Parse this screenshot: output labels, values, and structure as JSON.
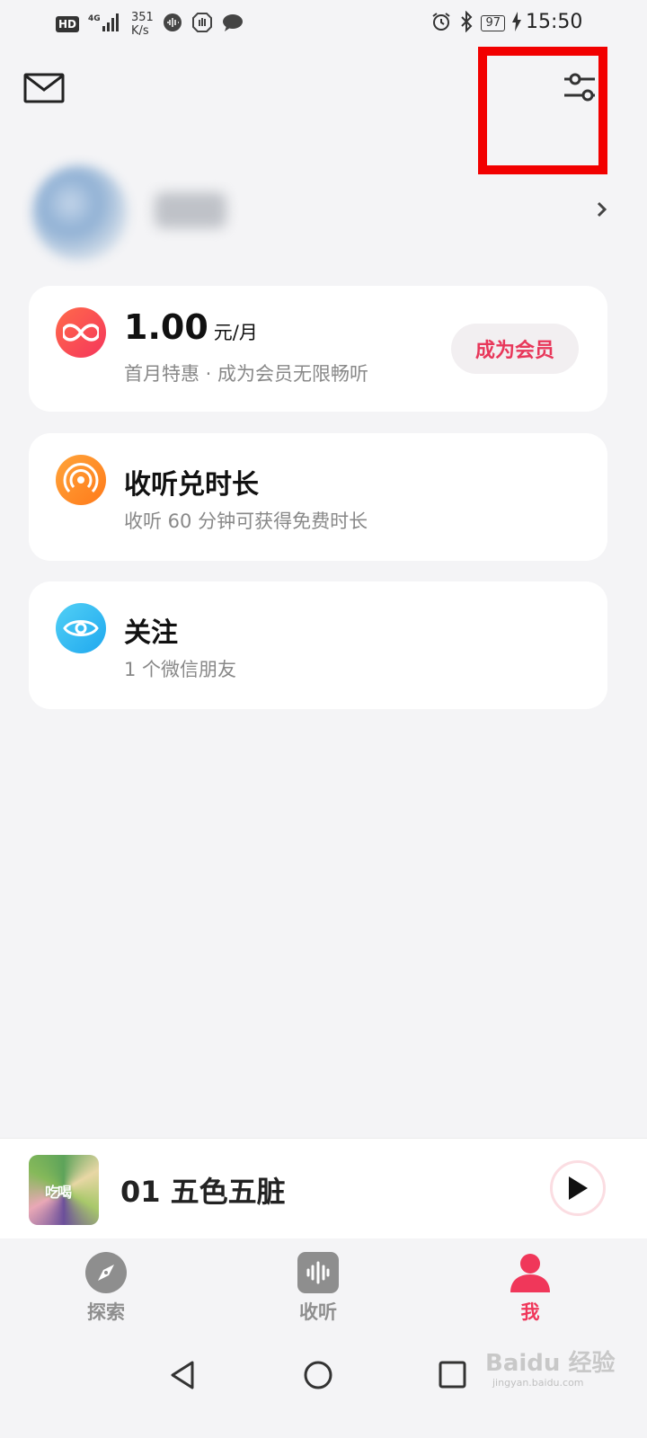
{
  "status_bar": {
    "hd": "HD",
    "network": "4G",
    "speed_value": "351",
    "speed_unit": "K/s",
    "battery": "97",
    "time": "15:50"
  },
  "header": {
    "mail_icon": "mail-icon",
    "settings_icon": "sliders-icon"
  },
  "profile": {
    "chevron_icon": "chevron-right-icon"
  },
  "vip": {
    "price": "1.00",
    "price_unit": "元/月",
    "subtitle": "首月特惠 · 成为会员无限畅听",
    "button_label": "成为会员",
    "icon": "infinity-icon",
    "accent": "#e8375a"
  },
  "listen_reward": {
    "title": "收听兑时长",
    "subtitle": "收听 60 分钟可获得免费时长",
    "icon": "broadcast-icon"
  },
  "follow": {
    "title": "关注",
    "subtitle": "1 个微信朋友",
    "icon": "eye-icon"
  },
  "player": {
    "track_title": "01 五色五脏",
    "album_text": "吃喝",
    "play_icon": "play-icon"
  },
  "tabs": [
    {
      "label": "探索",
      "icon": "compass-icon",
      "active": false
    },
    {
      "label": "收听",
      "icon": "waveform-icon",
      "active": false
    },
    {
      "label": "我",
      "icon": "person-icon",
      "active": true
    }
  ],
  "colors": {
    "tab_inactive": "#8e8e8e",
    "tab_active": "#f0375a"
  },
  "watermark": {
    "brand": "Baidu 经验",
    "url": "jingyan.baidu.com"
  }
}
